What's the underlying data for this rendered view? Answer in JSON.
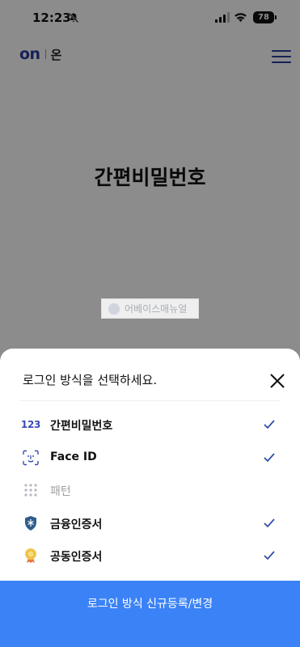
{
  "status_bar": {
    "time": "12:23",
    "battery": "78",
    "icons": [
      "bell-slash-icon",
      "cellular-signal-icon",
      "wifi-icon",
      "battery-icon"
    ]
  },
  "header": {
    "logo_mark": "on",
    "logo_text": "온",
    "menu_icon": "hamburger-menu-icon"
  },
  "main": {
    "title": "간편비밀번호"
  },
  "watermark": {
    "text": "어베이스매뉴얼"
  },
  "sheet": {
    "title": "로그인 방식을 선택하세요.",
    "close_icon": "close-icon",
    "options": [
      {
        "label": "간편비밀번호",
        "icon": "123",
        "icon_name": "pin-123-icon",
        "enabled": true,
        "checked": true
      },
      {
        "label": "Face ID",
        "icon": "face-id-icon",
        "enabled": true,
        "checked": true
      },
      {
        "label": "패턴",
        "icon": "pattern-dots-icon",
        "enabled": false,
        "checked": false
      },
      {
        "label": "금융인증서",
        "icon": "shield-certificate-icon",
        "enabled": true,
        "checked": true
      },
      {
        "label": "공동인증서",
        "icon": "medal-certificate-icon",
        "enabled": true,
        "checked": true
      }
    ],
    "cta_label": "로그인 방식 신규등록/변경"
  },
  "colors": {
    "brand": "#2c3c9e",
    "check": "#2f4fa8",
    "cta": "#3b82f6",
    "disabled_text": "#a0a0a0"
  }
}
